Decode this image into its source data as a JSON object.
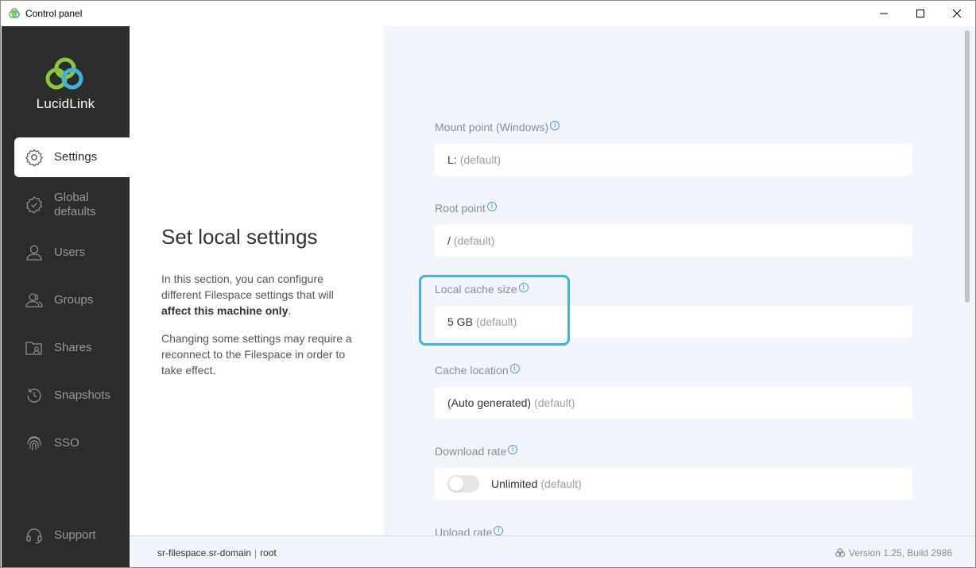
{
  "window": {
    "title": "Control panel"
  },
  "brand": {
    "name": "LucidLink",
    "green": "#8dc63f",
    "blue": "#3fb2e0"
  },
  "sidebar": {
    "items": [
      {
        "label": "Settings",
        "icon": "gear-icon",
        "active": true
      },
      {
        "label": "Global defaults",
        "icon": "badge-gear-icon"
      },
      {
        "label": "Users",
        "icon": "user-icon"
      },
      {
        "label": "Groups",
        "icon": "group-icon"
      },
      {
        "label": "Shares",
        "icon": "shares-icon"
      },
      {
        "label": "Snapshots",
        "icon": "history-icon"
      },
      {
        "label": "SSO",
        "icon": "fingerprint-icon"
      }
    ],
    "support": {
      "label": "Support",
      "icon": "headset-icon"
    }
  },
  "left": {
    "heading": "Set local settings",
    "para1_pre": "In this section, you can configure different Filespace settings that will ",
    "para1_bold": "affect this machine only",
    "para1_post": ".",
    "para2": "Changing some settings may require a reconnect to the Filespace in order to take effect."
  },
  "fields": [
    {
      "label": "Mount point (Windows)",
      "value": "L:",
      "default": "(default)"
    },
    {
      "label": "Root point",
      "value": "/",
      "default": "(default)"
    },
    {
      "label": "Local cache size",
      "value": "5 GB",
      "default": "(default)"
    },
    {
      "label": "Cache location",
      "value": "(Auto generated)",
      "default": "(default)"
    },
    {
      "label": "Download rate",
      "value": "Unlimited",
      "default": "(default)",
      "toggle": false
    },
    {
      "label": "Upload rate"
    }
  ],
  "footer": {
    "filespace": "sr-filespace.sr-domain",
    "user": "root",
    "version": "Version 1.25, Build 2986"
  }
}
